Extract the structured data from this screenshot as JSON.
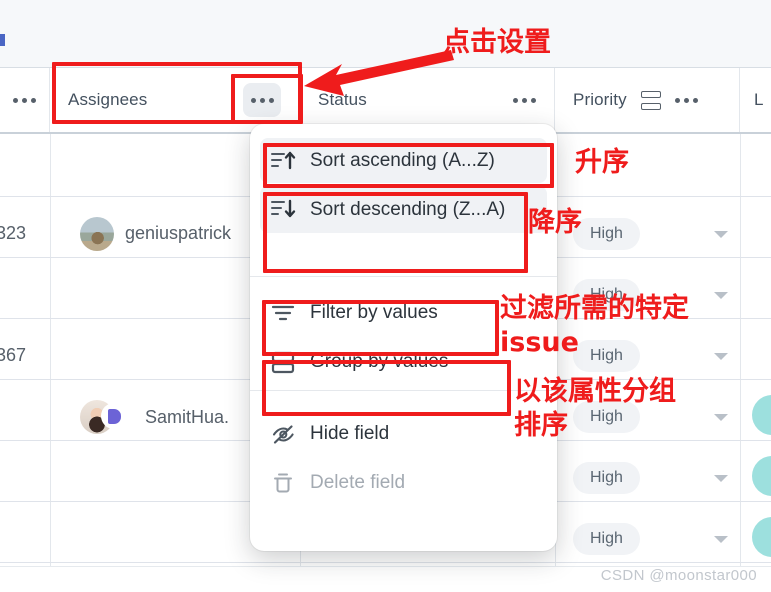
{
  "table": {
    "columns": [
      {
        "label": "",
        "menu_icon": "ellipsis-icon"
      },
      {
        "label": "Assignees",
        "menu_icon": "ellipsis-icon"
      },
      {
        "label": "Status",
        "menu_icon": "ellipsis-icon"
      },
      {
        "label": "Priority",
        "group_icon": "group-rows-icon",
        "menu_icon": "ellipsis-icon"
      },
      {
        "label": "L",
        "menu_icon": ""
      }
    ],
    "rows": [
      {
        "id": "323",
        "assignee": "geniuspatrick",
        "avatar": "avatar-dog-photo",
        "priority": "High"
      },
      {
        "id": "",
        "assignee": "",
        "avatar": "",
        "priority": "High"
      },
      {
        "id": "367",
        "assignee": "",
        "avatar": "",
        "priority": "High"
      },
      {
        "id": "",
        "assignee": "SamitHua.",
        "avatar": "avatar-person-photo",
        "priority": "High"
      },
      {
        "id": "",
        "assignee": "",
        "avatar": "",
        "priority": "High"
      },
      {
        "id": "",
        "assignee": "",
        "avatar": "",
        "priority": "High"
      }
    ]
  },
  "menu": {
    "items": [
      {
        "label": "Sort ascending (A...Z)",
        "icon": "sort-ascending-icon",
        "highlighted": true,
        "disabled": false
      },
      {
        "label": "Sort descending (Z...A)",
        "icon": "sort-descending-icon",
        "highlighted": true,
        "disabled": false
      },
      {
        "label": "Filter by values",
        "icon": "filter-icon",
        "highlighted": false,
        "disabled": false
      },
      {
        "label": "Group by values",
        "icon": "group-rows-icon",
        "highlighted": false,
        "disabled": false
      },
      {
        "label": "Hide field",
        "icon": "eye-off-icon",
        "highlighted": false,
        "disabled": false
      },
      {
        "label": "Delete field",
        "icon": "trash-icon",
        "highlighted": false,
        "disabled": true
      }
    ]
  },
  "annotations": {
    "click_settings": "点击设置",
    "ascending": "升序",
    "descending": "降序",
    "filter_issue": "过滤所需的特定",
    "filter_issue_2": "issue",
    "group_by_attr": "以该属性分组",
    "sort_label": "排序"
  },
  "watermark": "CSDN @moonstar000",
  "colors": {
    "annotation_red": "#ef1c1c",
    "header_text": "#44515f",
    "pill_bg": "#f1f3f6",
    "teal": "#9de0de",
    "menu_highlight": "#f0f2f5"
  }
}
